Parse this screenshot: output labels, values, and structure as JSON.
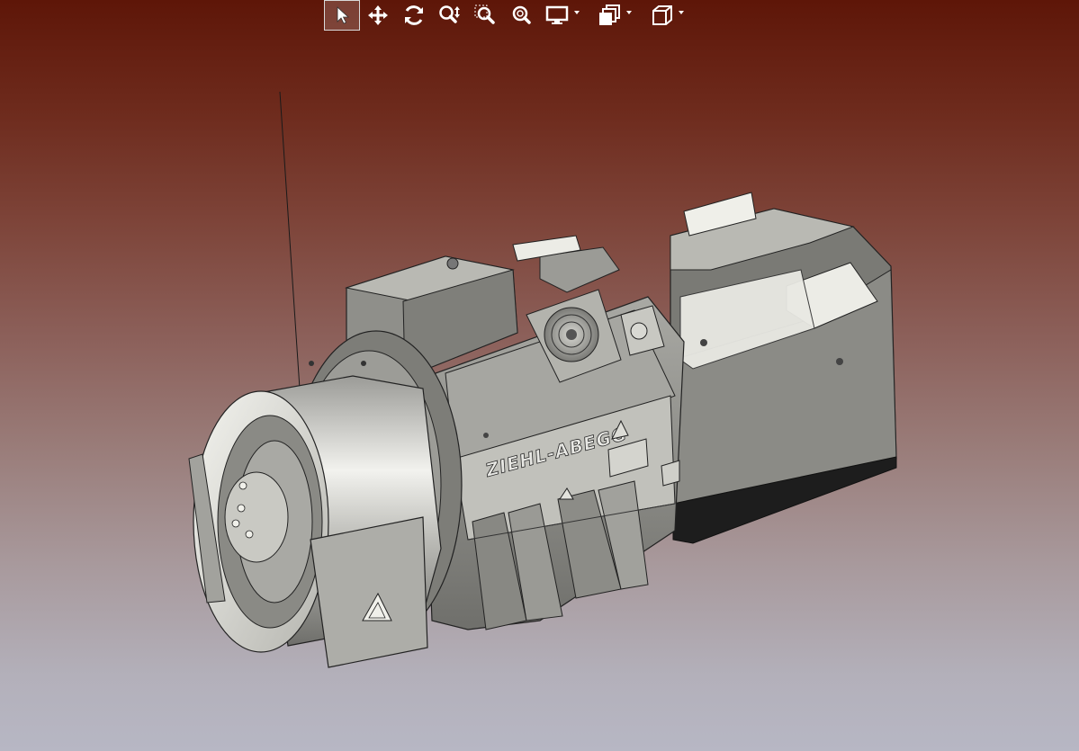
{
  "app": {
    "background_top": "#5e1608",
    "background_bottom": "#b7b7c4"
  },
  "toolbar": {
    "buttons": [
      {
        "id": "select",
        "icon": "cursor-arrow-icon",
        "active": true
      },
      {
        "id": "pan",
        "icon": "move-arrows-icon"
      },
      {
        "id": "rotate",
        "icon": "rotate-icon"
      },
      {
        "id": "zoom",
        "icon": "zoom-icon"
      },
      {
        "id": "zoom-window",
        "icon": "zoom-window-icon"
      },
      {
        "id": "zoom-fit",
        "icon": "zoom-fit-icon"
      },
      {
        "id": "display-mode",
        "icon": "monitor-icon",
        "dropdown": true
      },
      {
        "id": "section-views",
        "icon": "layers-icon",
        "dropdown": true
      },
      {
        "id": "view-orientation",
        "icon": "cube-icon",
        "dropdown": true
      }
    ]
  },
  "model": {
    "brand_label": "ZIEHL-ABEGG",
    "body_color": "#8a8a86",
    "highlight_color": "#e6e6e0"
  }
}
